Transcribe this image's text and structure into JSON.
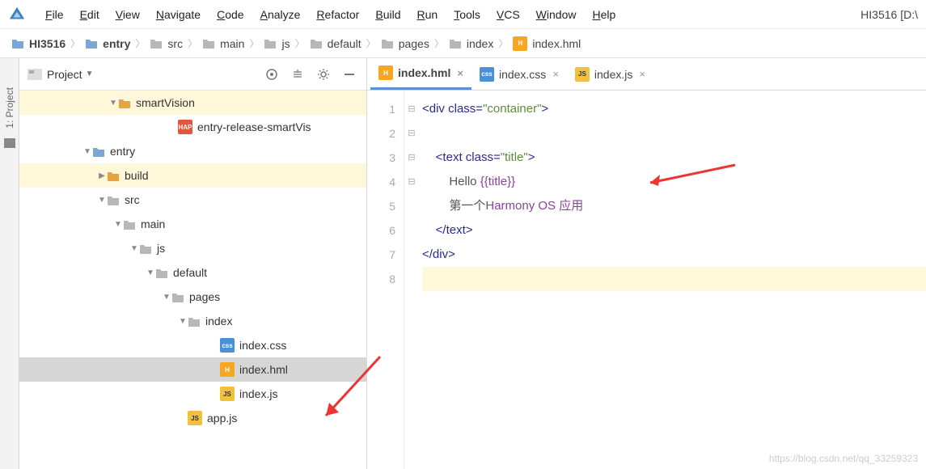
{
  "menu": {
    "items": [
      "File",
      "Edit",
      "View",
      "Navigate",
      "Code",
      "Analyze",
      "Refactor",
      "Build",
      "Run",
      "Tools",
      "VCS",
      "Window",
      "Help"
    ],
    "project_label": "HI3516 [D:\\"
  },
  "breadcrumb": [
    {
      "label": "HI3516",
      "bold": true,
      "icon": "folder-blue"
    },
    {
      "label": "entry",
      "bold": true,
      "icon": "folder-blue"
    },
    {
      "label": "src",
      "bold": false,
      "icon": "folder-gray"
    },
    {
      "label": "main",
      "bold": false,
      "icon": "folder-gray"
    },
    {
      "label": "js",
      "bold": false,
      "icon": "folder-gray"
    },
    {
      "label": "default",
      "bold": false,
      "icon": "folder-gray"
    },
    {
      "label": "pages",
      "bold": false,
      "icon": "folder-gray"
    },
    {
      "label": "index",
      "bold": false,
      "icon": "folder-gray"
    },
    {
      "label": "index.hml",
      "bold": false,
      "icon": "file-hml"
    }
  ],
  "sidebar_tab": "1: Project",
  "project_panel": {
    "title": "Project",
    "tools": [
      "target-icon",
      "collapse-icon",
      "gear-icon",
      "minimize-icon"
    ]
  },
  "tree": [
    {
      "indent": 110,
      "arrow": "▼",
      "icon": "folder-orange",
      "label": "smartVision",
      "hl": true
    },
    {
      "indent": 184,
      "arrow": "",
      "icon": "file-hap",
      "label": "entry-release-smartVis",
      "hl": false
    },
    {
      "indent": 78,
      "arrow": "▼",
      "icon": "folder-blue",
      "label": "entry",
      "hl": false
    },
    {
      "indent": 96,
      "arrow": "▶",
      "icon": "folder-orange",
      "label": "build",
      "hl": true
    },
    {
      "indent": 96,
      "arrow": "▼",
      "icon": "folder-gray",
      "label": "src",
      "hl": false
    },
    {
      "indent": 116,
      "arrow": "▼",
      "icon": "folder-gray",
      "label": "main",
      "hl": false
    },
    {
      "indent": 136,
      "arrow": "▼",
      "icon": "folder-gray",
      "label": "js",
      "hl": false
    },
    {
      "indent": 156,
      "arrow": "▼",
      "icon": "folder-gray",
      "label": "default",
      "hl": false
    },
    {
      "indent": 176,
      "arrow": "▼",
      "icon": "folder-gray",
      "label": "pages",
      "hl": false
    },
    {
      "indent": 196,
      "arrow": "▼",
      "icon": "folder-gray",
      "label": "index",
      "hl": false
    },
    {
      "indent": 236,
      "arrow": "",
      "icon": "file-css",
      "label": "index.css",
      "hl": false
    },
    {
      "indent": 236,
      "arrow": "",
      "icon": "file-hml",
      "label": "index.hml",
      "hl": false,
      "sel": true
    },
    {
      "indent": 236,
      "arrow": "",
      "icon": "file-js",
      "label": "index.js",
      "hl": false
    },
    {
      "indent": 196,
      "arrow": "",
      "icon": "file-js",
      "label": "app.js",
      "hl": false
    }
  ],
  "editor": {
    "tabs": [
      {
        "icon": "file-hml",
        "label": "index.hml",
        "active": true
      },
      {
        "icon": "file-css",
        "label": "index.css",
        "active": false
      },
      {
        "icon": "file-js",
        "label": "index.js",
        "active": false
      }
    ],
    "lines": [
      {
        "n": 1,
        "fold": "⊟",
        "html": "<span class='t-tag'>&lt;div </span><span class='t-attr'>class</span><span class='t-tag'>=</span><span class='t-str'>\"container\"</span><span class='t-tag'>&gt;</span>"
      },
      {
        "n": 2,
        "fold": "",
        "html": ""
      },
      {
        "n": 3,
        "fold": "⊟",
        "html": "    <span class='t-tag'>&lt;text </span><span class='t-attr'>class</span><span class='t-tag'>=</span><span class='t-str'>\"title\"</span><span class='t-tag'>&gt;</span>"
      },
      {
        "n": 4,
        "fold": "",
        "html": "        <span class='t-txt'>Hello </span><span class='t-var'>{{title}}</span>"
      },
      {
        "n": 5,
        "fold": "",
        "html": "        <span class='t-txt'>第一个</span><span class='t-var'>Harmony OS 应用</span>"
      },
      {
        "n": 6,
        "fold": "⊟",
        "html": "    <span class='t-tag'>&lt;/text&gt;</span>"
      },
      {
        "n": 7,
        "fold": "⊟",
        "html": "<span class='t-tag'>&lt;/div&gt;</span>"
      },
      {
        "n": 8,
        "fold": "",
        "html": "",
        "cur": true
      }
    ]
  },
  "watermark": "https://blog.csdn.net/qq_33259323"
}
